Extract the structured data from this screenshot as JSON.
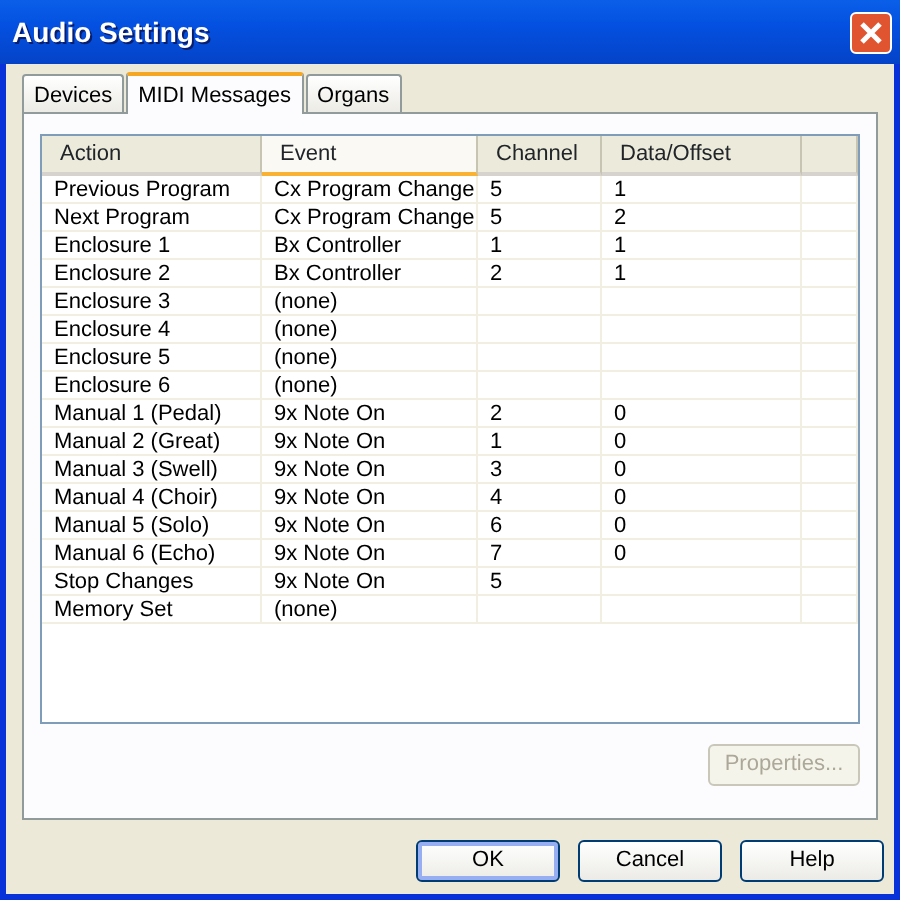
{
  "window": {
    "title": "Audio Settings"
  },
  "tabs": [
    {
      "label": "Devices",
      "selected": false
    },
    {
      "label": "MIDI Messages",
      "selected": true
    },
    {
      "label": "Organs",
      "selected": false
    }
  ],
  "table": {
    "columns": [
      {
        "label": "Action",
        "selected": false
      },
      {
        "label": "Event",
        "selected": true
      },
      {
        "label": "Channel",
        "selected": false
      },
      {
        "label": "Data/Offset",
        "selected": false
      }
    ],
    "rows": [
      [
        "Previous Program",
        "Cx Program Change",
        "5",
        "1"
      ],
      [
        "Next Program",
        "Cx Program Change",
        "5",
        "2"
      ],
      [
        "Enclosure 1",
        "Bx Controller",
        "1",
        "1"
      ],
      [
        "Enclosure 2",
        "Bx Controller",
        "2",
        "1"
      ],
      [
        "Enclosure 3",
        "(none)",
        "",
        ""
      ],
      [
        "Enclosure 4",
        "(none)",
        "",
        ""
      ],
      [
        "Enclosure 5",
        "(none)",
        "",
        ""
      ],
      [
        "Enclosure 6",
        "(none)",
        "",
        ""
      ],
      [
        "Manual 1 (Pedal)",
        "9x Note On",
        "2",
        "0"
      ],
      [
        "Manual 2 (Great)",
        "9x Note On",
        "1",
        "0"
      ],
      [
        "Manual 3 (Swell)",
        "9x Note On",
        "3",
        "0"
      ],
      [
        "Manual 4 (Choir)",
        "9x Note On",
        "4",
        "0"
      ],
      [
        "Manual 5 (Solo)",
        "9x Note On",
        "6",
        "0"
      ],
      [
        "Manual 6 (Echo)",
        "9x Note On",
        "7",
        "0"
      ],
      [
        "Stop Changes",
        "9x Note On",
        "5",
        ""
      ],
      [
        "Memory Set",
        "(none)",
        "",
        ""
      ]
    ]
  },
  "properties_button": {
    "label": "Properties...",
    "disabled": true
  },
  "buttons": [
    {
      "label": "OK",
      "default": true
    },
    {
      "label": "Cancel",
      "default": false
    },
    {
      "label": "Help",
      "default": false
    }
  ]
}
